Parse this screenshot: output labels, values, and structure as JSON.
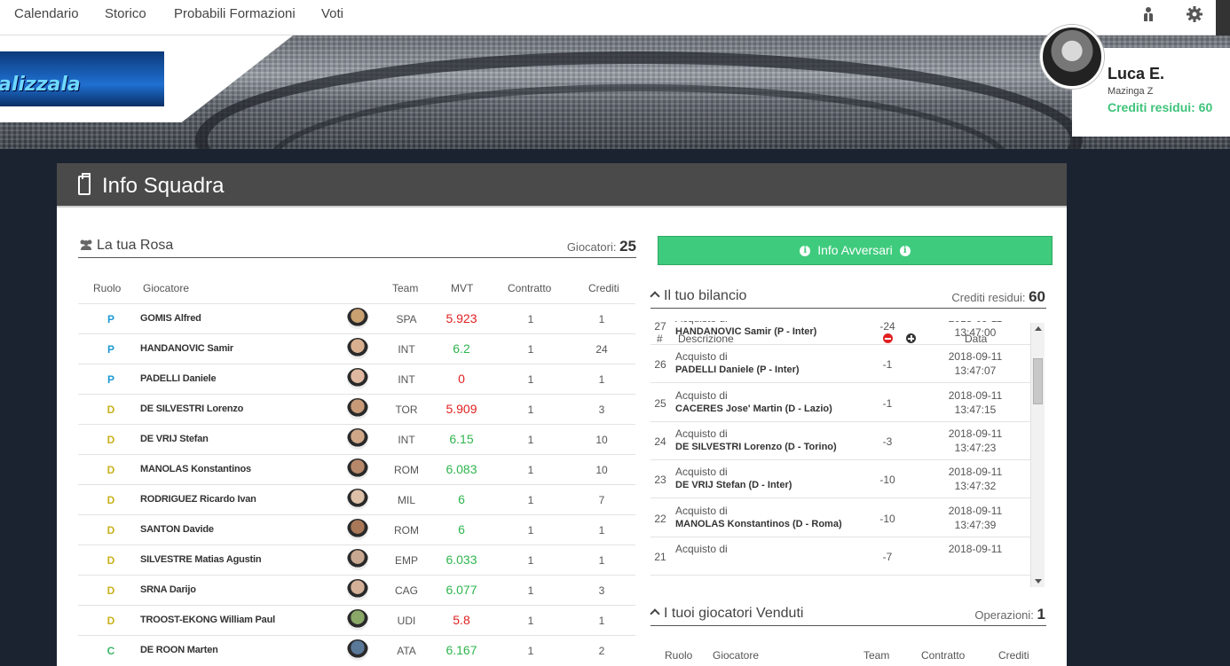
{
  "nav": {
    "items": [
      "Calendario",
      "Storico",
      "Probabili Formazioni",
      "Voti"
    ],
    "icons": [
      "people-icon",
      "gear-icon"
    ]
  },
  "banner": {
    "logo_text": "alizzala"
  },
  "user": {
    "name": "Luca E.",
    "team": "Mazinga Z",
    "credits_label": "Crediti residui: 60"
  },
  "panel": {
    "title": "Info Squadra"
  },
  "roster": {
    "title": "La tua Rosa",
    "count_label": "Giocatori:",
    "count": "25",
    "headers": [
      "Ruolo",
      "Giocatore",
      "Team",
      "MVT",
      "Contratto",
      "Crediti"
    ],
    "rows": [
      {
        "ruolo": "P",
        "nome": "GOMIS Alfred",
        "team": "SPA",
        "mvt": "5.923",
        "mvt_color": "red",
        "contratto": "1",
        "crediti": "1"
      },
      {
        "ruolo": "P",
        "nome": "HANDANOVIC Samir",
        "team": "INT",
        "mvt": "6.2",
        "mvt_color": "green",
        "contratto": "1",
        "crediti": "24"
      },
      {
        "ruolo": "P",
        "nome": "PADELLI Daniele",
        "team": "INT",
        "mvt": "0",
        "mvt_color": "red",
        "contratto": "1",
        "crediti": "1"
      },
      {
        "ruolo": "D",
        "nome": "DE SILVESTRI Lorenzo",
        "team": "TOR",
        "mvt": "5.909",
        "mvt_color": "red",
        "contratto": "1",
        "crediti": "3"
      },
      {
        "ruolo": "D",
        "nome": "DE VRIJ Stefan",
        "team": "INT",
        "mvt": "6.15",
        "mvt_color": "green",
        "contratto": "1",
        "crediti": "10"
      },
      {
        "ruolo": "D",
        "nome": "MANOLAS Konstantinos",
        "team": "ROM",
        "mvt": "6.083",
        "mvt_color": "green",
        "contratto": "1",
        "crediti": "10"
      },
      {
        "ruolo": "D",
        "nome": "RODRIGUEZ Ricardo Ivan",
        "team": "MIL",
        "mvt": "6",
        "mvt_color": "green",
        "contratto": "1",
        "crediti": "7"
      },
      {
        "ruolo": "D",
        "nome": "SANTON Davide",
        "team": "ROM",
        "mvt": "6",
        "mvt_color": "green",
        "contratto": "1",
        "crediti": "1"
      },
      {
        "ruolo": "D",
        "nome": "SILVESTRE Matias Agustin",
        "team": "EMP",
        "mvt": "6.033",
        "mvt_color": "green",
        "contratto": "1",
        "crediti": "1"
      },
      {
        "ruolo": "D",
        "nome": "SRNA Darijo",
        "team": "CAG",
        "mvt": "6.077",
        "mvt_color": "green",
        "contratto": "1",
        "crediti": "3"
      },
      {
        "ruolo": "D",
        "nome": "TROOST-EKONG William Paul",
        "team": "UDI",
        "mvt": "5.8",
        "mvt_color": "red",
        "contratto": "1",
        "crediti": "1"
      },
      {
        "ruolo": "C",
        "nome": "DE ROON Marten",
        "team": "ATA",
        "mvt": "6.167",
        "mvt_color": "green",
        "contratto": "1",
        "crediti": "2"
      }
    ]
  },
  "avversari": {
    "button_label": "Info Avversari"
  },
  "bilancio": {
    "title": "Il tuo bilancio",
    "credits_label": "Crediti residui:",
    "credits": "60",
    "headers": {
      "num": "#",
      "desc": "Descrizione",
      "date": "Data"
    },
    "rows": [
      {
        "num": "27",
        "d1": "Acquisto di",
        "d2": "HANDANOVIC Samir (P - Inter)",
        "amt": "-24",
        "dt1": "2018-09-11",
        "dt2": "13:47:00"
      },
      {
        "num": "26",
        "d1": "Acquisto di",
        "d2": "PADELLI Daniele (P - Inter)",
        "amt": "-1",
        "dt1": "2018-09-11",
        "dt2": "13:47:07"
      },
      {
        "num": "25",
        "d1": "Acquisto di",
        "d2": "CACERES Jose' Martin (D - Lazio)",
        "amt": "-1",
        "dt1": "2018-09-11",
        "dt2": "13:47:15"
      },
      {
        "num": "24",
        "d1": "Acquisto di",
        "d2": "DE SILVESTRI Lorenzo (D - Torino)",
        "amt": "-3",
        "dt1": "2018-09-11",
        "dt2": "13:47:23"
      },
      {
        "num": "23",
        "d1": "Acquisto di",
        "d2": "DE VRIJ Stefan (D - Inter)",
        "amt": "-10",
        "dt1": "2018-09-11",
        "dt2": "13:47:32"
      },
      {
        "num": "22",
        "d1": "Acquisto di",
        "d2": "MANOLAS Konstantinos (D - Roma)",
        "amt": "-10",
        "dt1": "2018-09-11",
        "dt2": "13:47:39"
      },
      {
        "num": "21",
        "d1": "Acquisto di",
        "d2": "",
        "amt": "-7",
        "dt1": "2018-09-11",
        "dt2": ""
      }
    ]
  },
  "venduti": {
    "title": "I tuoi giocatori Venduti",
    "ops_label": "Operazioni:",
    "ops": "1",
    "headers": [
      "Ruolo",
      "Giocatore",
      "Team",
      "Contratto",
      "Crediti"
    ]
  }
}
